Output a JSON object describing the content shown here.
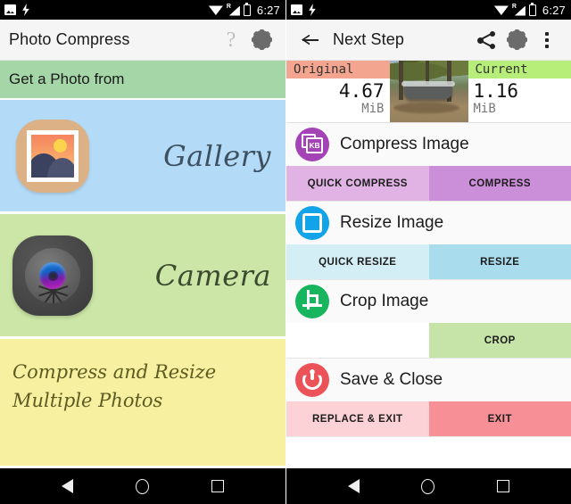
{
  "status_bar": {
    "time": "6:27",
    "left_icons": [
      "screenshot-icon",
      "charging-bolt-icon"
    ],
    "right_icons": [
      "wifi-icon",
      "cell-signal-roaming-icon",
      "battery-icon"
    ],
    "roaming_label": "R"
  },
  "left_screen": {
    "appbar": {
      "title": "Photo Compress",
      "help_glyph": "?",
      "icons": [
        "help-icon",
        "gear-icon"
      ]
    },
    "section_header": "Get a Photo from",
    "options": [
      {
        "label": "Gallery",
        "icon": "gallery-icon",
        "bg": "#b3daf7"
      },
      {
        "label": "Camera",
        "icon": "camera-icon",
        "bg": "#cbe6a6"
      }
    ],
    "promo_text": "Compress and Resize Multiple Photos",
    "promo_bg": "#f7f0a0",
    "header_bg": "#a5d6a7"
  },
  "right_screen": {
    "appbar": {
      "title": "Next Step",
      "icons": [
        "back-arrow-icon",
        "share-icon",
        "gear-icon",
        "overflow-menu-icon"
      ]
    },
    "size_bar": {
      "original": {
        "tag": "Original",
        "value": "4.67",
        "unit": "MiB",
        "tag_bg": "#f4a58f"
      },
      "current": {
        "tag": "Current",
        "value": "1.16",
        "unit": "MiB",
        "tag_bg": "#b6ee79"
      },
      "thumbnail_alt": "park-photo-thumbnail"
    },
    "actions": [
      {
        "title": "Compress Image",
        "icon": "compress-kb-icon",
        "icon_color": "#a443b5",
        "icon_text": "KB",
        "buttons": [
          {
            "label": "QUICK COMPRESS",
            "bg": "#e0b3e4"
          },
          {
            "label": "COMPRESS",
            "bg": "#cb8ed9"
          }
        ]
      },
      {
        "title": "Resize Image",
        "icon": "resize-icon",
        "icon_color": "#12a3e8",
        "buttons": [
          {
            "label": "QUICK RESIZE",
            "bg": "#d3eef5"
          },
          {
            "label": "RESIZE",
            "bg": "#a9dcec"
          }
        ]
      },
      {
        "title": "Crop Image",
        "icon": "crop-icon",
        "icon_color": "#17b55e",
        "buttons": [
          {
            "label": "",
            "bg": "#ffffff"
          },
          {
            "label": "CROP",
            "bg": "#c6e4a8"
          }
        ]
      },
      {
        "title": "Save & Close",
        "icon": "power-icon",
        "icon_color": "#ec5359",
        "buttons": [
          {
            "label": "REPLACE & EXIT",
            "bg": "#fcd2d6"
          },
          {
            "label": "EXIT",
            "bg": "#f79096"
          }
        ]
      }
    ]
  },
  "nav_bar": {
    "items": [
      "back-nav-icon",
      "home-nav-icon",
      "recents-nav-icon"
    ]
  }
}
